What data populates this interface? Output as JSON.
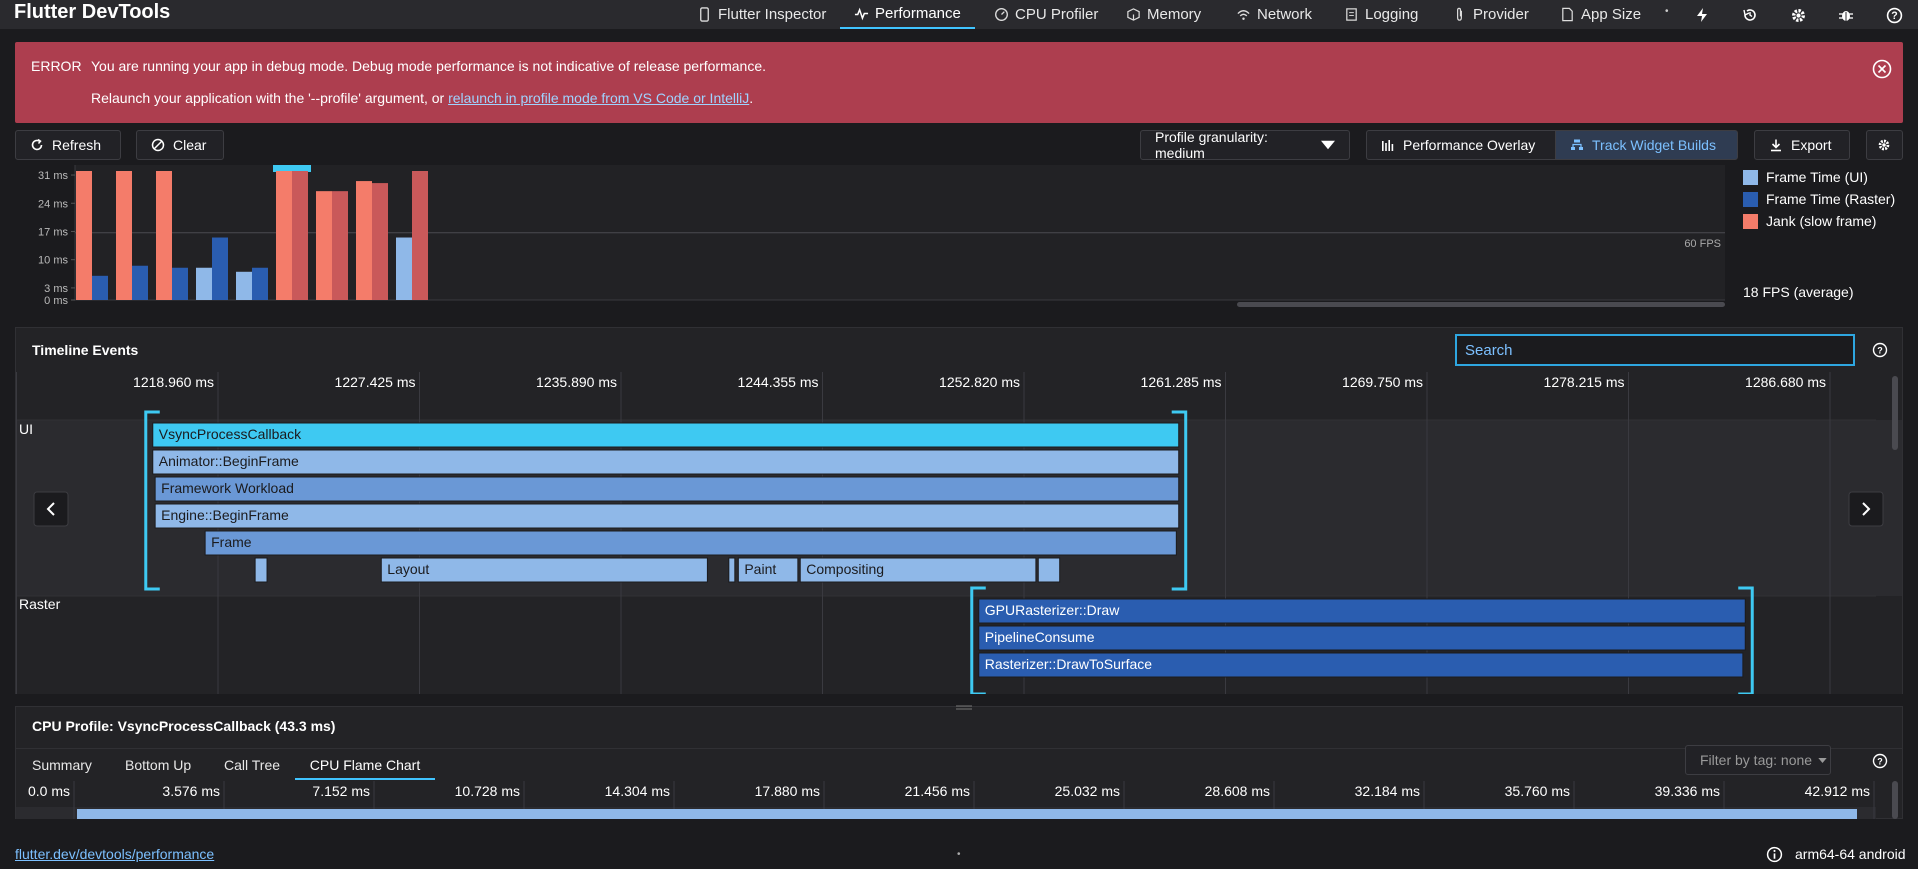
{
  "app": {
    "title": "Flutter DevTools"
  },
  "nav": {
    "tabs": [
      {
        "label": "Flutter Inspector",
        "icon": "phone-icon"
      },
      {
        "label": "Performance",
        "icon": "pulse-icon",
        "active": true
      },
      {
        "label": "CPU Profiler",
        "icon": "gauge-icon"
      },
      {
        "label": "Memory",
        "icon": "memory-icon"
      },
      {
        "label": "Network",
        "icon": "wifi-icon"
      },
      {
        "label": "Logging",
        "icon": "logging-icon"
      },
      {
        "label": "Provider",
        "icon": "attach-icon"
      },
      {
        "label": "App Size",
        "icon": "file-icon"
      }
    ],
    "action_icons": [
      "bolt-icon",
      "history-icon",
      "settings-icon",
      "bug-icon",
      "help-icon"
    ]
  },
  "error": {
    "label": "ERROR",
    "line1": "You are running your app in debug mode. Debug mode performance is not indicative of release performance.",
    "line2_prefix": "Relaunch your application with the '--profile' argument, or ",
    "line2_link": "relaunch in profile mode from VS Code or IntelliJ",
    "line2_suffix": "."
  },
  "toolbar": {
    "refresh": "Refresh",
    "clear": "Clear",
    "granularity": "Profile granularity: medium",
    "overlay": "Performance Overlay",
    "track": "Track Widget Builds",
    "export": "Export"
  },
  "frames_chart": {
    "legend": [
      {
        "label": "Frame Time (UI)",
        "color": "#8fb8e8"
      },
      {
        "label": "Frame Time (Raster)",
        "color": "#2a5db0"
      },
      {
        "label": "Jank (slow frame)",
        "color": "#f47c6a"
      }
    ],
    "fps_label": "60 FPS",
    "fps_average": "18 FPS (average)"
  },
  "chart_data": {
    "type": "bar",
    "yticks": [
      "31 ms",
      "24 ms",
      "17 ms",
      "10 ms",
      "3 ms",
      "0 ms"
    ],
    "ylim": [
      0,
      32
    ],
    "frames": [
      {
        "ui": 32,
        "raster": 6,
        "ui_jank": true,
        "raster_jank": false
      },
      {
        "ui": 32,
        "raster": 8.5,
        "ui_jank": true,
        "raster_jank": false
      },
      {
        "ui": 32,
        "raster": 8,
        "ui_jank": true,
        "raster_jank": false
      },
      {
        "ui": 8,
        "raster": 15.5,
        "ui_jank": false,
        "raster_jank": false
      },
      {
        "ui": 7,
        "raster": 8,
        "ui_jank": false,
        "raster_jank": false
      },
      {
        "ui": 32,
        "raster": 32,
        "ui_jank": true,
        "raster_jank": true,
        "selected": true
      },
      {
        "ui": 27,
        "raster": 27,
        "ui_jank": true,
        "raster_jank": true
      },
      {
        "ui": 29.5,
        "raster": 29,
        "ui_jank": true,
        "raster_jank": true
      },
      {
        "ui": 15.5,
        "raster": 32,
        "ui_jank": false,
        "raster_jank": true
      }
    ]
  },
  "timeline": {
    "title": "Timeline Events",
    "search_placeholder": "Search",
    "ticks": [
      "1218.960 ms",
      "1227.425 ms",
      "1235.890 ms",
      "1244.355 ms",
      "1252.820 ms",
      "1261.285 ms",
      "1269.750 ms",
      "1278.215 ms",
      "1286.680 ms"
    ],
    "ui_label": "UI",
    "raster_label": "Raster",
    "ui_events": [
      {
        "name": "VsyncProcessCallback",
        "start": 1217.9,
        "end": 1261.0,
        "row": 0,
        "color": "#3ec9f2"
      },
      {
        "name": "Animator::BeginFrame",
        "start": 1217.9,
        "end": 1261.0,
        "row": 1,
        "color": "#8fb8e8"
      },
      {
        "name": "Framework Workload",
        "start": 1218.0,
        "end": 1261.0,
        "row": 2,
        "color": "#6a98d6"
      },
      {
        "name": "Engine::BeginFrame",
        "start": 1218.0,
        "end": 1261.0,
        "row": 3,
        "color": "#8fb8e8"
      },
      {
        "name": "Frame",
        "start": 1220.1,
        "end": 1260.9,
        "row": 4,
        "color": "#6a98d6"
      },
      {
        "name": "",
        "start": 1222.2,
        "end": 1222.7,
        "row": 5,
        "color": "#8fb8e8"
      },
      {
        "name": "Layout",
        "start": 1227.5,
        "end": 1241.2,
        "row": 5,
        "color": "#8fb8e8"
      },
      {
        "name": "",
        "start": 1242.1,
        "end": 1242.3,
        "row": 5,
        "color": "#8fb8e8"
      },
      {
        "name": "Paint",
        "start": 1242.5,
        "end": 1245.0,
        "row": 5,
        "color": "#8fb8e8"
      },
      {
        "name": "Compositing",
        "start": 1245.1,
        "end": 1255.0,
        "row": 5,
        "color": "#8fb8e8"
      },
      {
        "name": "",
        "start": 1255.1,
        "end": 1256.0,
        "row": 5,
        "color": "#8fb8e8"
      }
    ],
    "raster_events": [
      {
        "name": "GPURasterizer::Draw",
        "start": 1252.6,
        "end": 1284.8,
        "row": 0,
        "color": "#2a5db0"
      },
      {
        "name": "PipelineConsume",
        "start": 1252.6,
        "end": 1284.8,
        "row": 1,
        "color": "#2a5db0"
      },
      {
        "name": "Rasterizer::DrawToSurface",
        "start": 1252.6,
        "end": 1284.7,
        "row": 2,
        "color": "#2a5db0"
      }
    ]
  },
  "cpu": {
    "title": "CPU Profile: VsyncProcessCallback (43.3 ms)",
    "tabs": [
      "Summary",
      "Bottom Up",
      "Call Tree",
      "CPU Flame Chart"
    ],
    "active_tab": "CPU Flame Chart",
    "filter": "Filter by tag: none",
    "ticks": [
      "0.0 ms",
      "3.576 ms",
      "7.152 ms",
      "10.728 ms",
      "14.304 ms",
      "17.880 ms",
      "21.456 ms",
      "25.032 ms",
      "28.608 ms",
      "32.184 ms",
      "35.760 ms",
      "39.336 ms",
      "42.912 ms"
    ]
  },
  "status": {
    "link": "flutter.dev/devtools/performance",
    "device": "arm64-64 android"
  }
}
